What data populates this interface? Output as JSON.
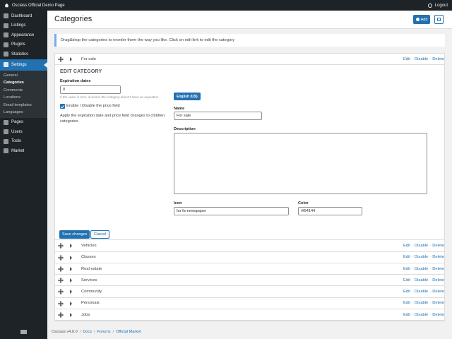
{
  "topbar": {
    "site_title": "Osclass Official Demo Page",
    "logout": "Logout",
    "home_icon": "home-icon",
    "logout_icon": "logout-icon"
  },
  "sidebar": {
    "items_top": [
      {
        "label": "Dashboard",
        "icon": "dashboard-icon"
      },
      {
        "label": "Listings",
        "icon": "listings-icon"
      },
      {
        "label": "Appearance",
        "icon": "appearance-icon"
      },
      {
        "label": "Plugins",
        "icon": "plugins-icon"
      },
      {
        "label": "Statistics",
        "icon": "statistics-icon"
      }
    ],
    "active": {
      "label": "Settings",
      "icon": "settings-icon"
    },
    "submenu": [
      "General",
      "Categories",
      "Comments",
      "Locations",
      "Email templates",
      "Languages"
    ],
    "items_bottom": [
      {
        "label": "Pages",
        "icon": "pages-icon"
      },
      {
        "label": "Users",
        "icon": "users-icon"
      },
      {
        "label": "Tools",
        "icon": "tools-icon"
      },
      {
        "label": "Market",
        "icon": "market-icon"
      }
    ]
  },
  "header": {
    "title": "Categories",
    "add_label": "Add"
  },
  "notice": "Drag&drop the categories to reorder them the way you like. Click on edit link to edit the category",
  "actions": {
    "edit": "Edit",
    "disable": "Disable",
    "delete": "Delete",
    "sep": "·"
  },
  "first_category": "For sale",
  "edit": {
    "title": "EDIT CATEGORY",
    "expiration_label": "Expiration dates",
    "expiration_value": "0",
    "expiration_hint": "If the value is zero, it means this category doesn't have an expiration",
    "price_toggle_label": "Enable / Disable the price field",
    "apply_children_text": "Apply the expiration date and price field changes to children categories",
    "lang_tab": "English (US)",
    "name_label": "Name",
    "name_value": "For sale",
    "description_label": "Description",
    "icon_label": "Icon",
    "icon_value": "far fa-newspaper",
    "color_label": "Color",
    "color_value": "#f94144",
    "save_label": "Save changes",
    "cancel_label": "Cancel"
  },
  "categories": [
    "Vehicles",
    "Classes",
    "Real estate",
    "Services",
    "Community",
    "Personals",
    "Jobs"
  ],
  "footer": {
    "version": "Osclass v4.0.0",
    "links": [
      "Docs",
      "Forums",
      "Official Market"
    ],
    "sep": "/"
  },
  "colors": {
    "accent": "#2271b1",
    "sidebar_bg": "#1d2327",
    "notice_border": "#72aee6"
  }
}
